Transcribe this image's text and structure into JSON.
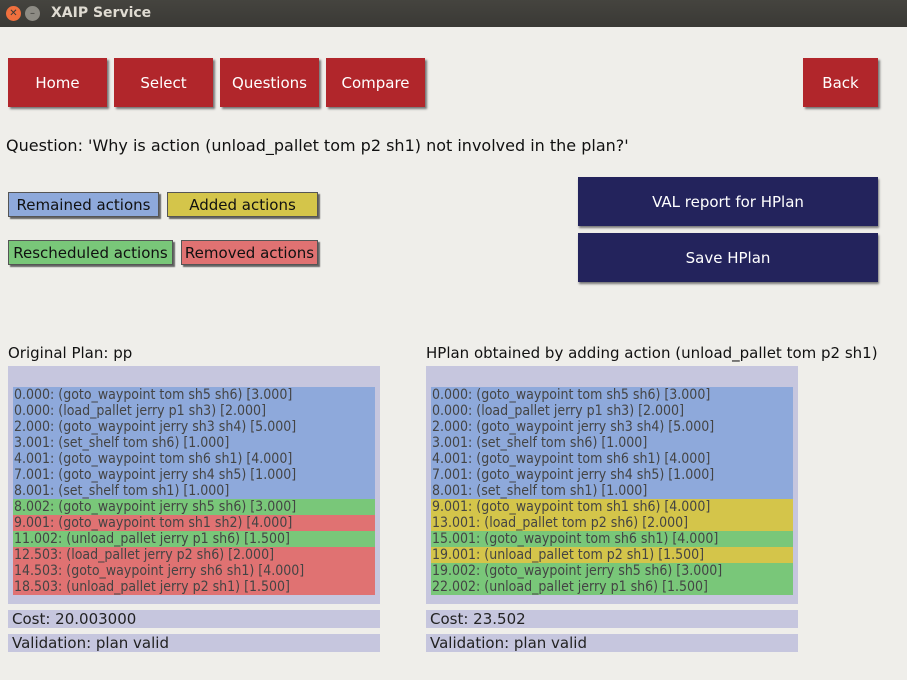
{
  "window": {
    "title": "XAIP Service"
  },
  "nav": {
    "home": "Home",
    "select": "Select",
    "questions": "Questions",
    "compare": "Compare",
    "back": "Back"
  },
  "question_text": "Question: 'Why is action (unload_pallet tom p2 sh1) not involved in the plan?'",
  "legend": {
    "remained": "Remained actions",
    "added": "Added actions",
    "rescheduled": "Rescheduled actions",
    "removed": "Removed actions"
  },
  "colors": {
    "remained": "#8ea9db",
    "added": "#d4c54a",
    "rescheduled": "#79c779",
    "removed": "#e07272",
    "nav": "#b1262b",
    "action_button": "#23235c",
    "panel": "#c6c6de"
  },
  "actions": {
    "val_report": "VAL report for  HPlan",
    "save": "Save HPlan"
  },
  "original": {
    "title": "Original Plan: pp",
    "rows": [
      {
        "text": "0.000: (goto_waypoint tom sh5 sh6)  [3.000]",
        "status": "remained"
      },
      {
        "text": "0.000: (load_pallet jerry p1 sh3)  [2.000]",
        "status": "remained"
      },
      {
        "text": "2.000: (goto_waypoint jerry sh3 sh4)  [5.000]",
        "status": "remained"
      },
      {
        "text": "3.001: (set_shelf tom sh6)  [1.000]",
        "status": "remained"
      },
      {
        "text": "4.001: (goto_waypoint tom sh6 sh1)  [4.000]",
        "status": "remained"
      },
      {
        "text": "7.001: (goto_waypoint jerry sh4 sh5)  [1.000]",
        "status": "remained"
      },
      {
        "text": "8.001: (set_shelf tom sh1)  [1.000]",
        "status": "remained"
      },
      {
        "text": "8.002: (goto_waypoint jerry sh5 sh6)  [3.000]",
        "status": "rescheduled"
      },
      {
        "text": "9.001: (goto_waypoint tom sh1 sh2)  [4.000]",
        "status": "removed"
      },
      {
        "text": "11.002: (unload_pallet jerry p1 sh6)  [1.500]",
        "status": "rescheduled"
      },
      {
        "text": "12.503: (load_pallet jerry p2 sh6)  [2.000]",
        "status": "removed"
      },
      {
        "text": "14.503: (goto_waypoint jerry sh6 sh1)  [4.000]",
        "status": "removed"
      },
      {
        "text": "18.503: (unload_pallet jerry p2 sh1)  [1.500]",
        "status": "removed"
      }
    ],
    "cost": "Cost: 20.003000",
    "validation": "Validation: plan valid"
  },
  "hplan": {
    "title": "HPlan obtained by adding action (unload_pallet tom p2 sh1)",
    "rows": [
      {
        "text": "0.000: (goto_waypoint tom sh5 sh6)  [3.000]",
        "status": "remained"
      },
      {
        "text": "0.000: (load_pallet jerry p1 sh3)  [2.000]",
        "status": "remained"
      },
      {
        "text": "2.000: (goto_waypoint jerry sh3 sh4)  [5.000]",
        "status": "remained"
      },
      {
        "text": "3.001: (set_shelf tom sh6)  [1.000]",
        "status": "remained"
      },
      {
        "text": "4.001: (goto_waypoint tom sh6 sh1)  [4.000]",
        "status": "remained"
      },
      {
        "text": "7.001: (goto_waypoint jerry sh4 sh5)  [1.000]",
        "status": "remained"
      },
      {
        "text": "8.001: (set_shelf tom sh1)  [1.000]",
        "status": "remained"
      },
      {
        "text": "9.001: (goto_waypoint tom sh1 sh6)  [4.000]",
        "status": "added"
      },
      {
        "text": "13.001: (load_pallet tom p2 sh6)  [2.000]",
        "status": "added"
      },
      {
        "text": "15.001: (goto_waypoint tom sh6 sh1)  [4.000]",
        "status": "rescheduled"
      },
      {
        "text": "19.001: (unload_pallet tom p2 sh1)  [1.500]",
        "status": "added"
      },
      {
        "text": "19.002: (goto_waypoint jerry sh5 sh6)  [3.000]",
        "status": "rescheduled"
      },
      {
        "text": "22.002: (unload_pallet jerry p1 sh6)  [1.500]",
        "status": "rescheduled"
      }
    ],
    "cost": "Cost: 23.502",
    "validation": "Validation: plan valid"
  }
}
